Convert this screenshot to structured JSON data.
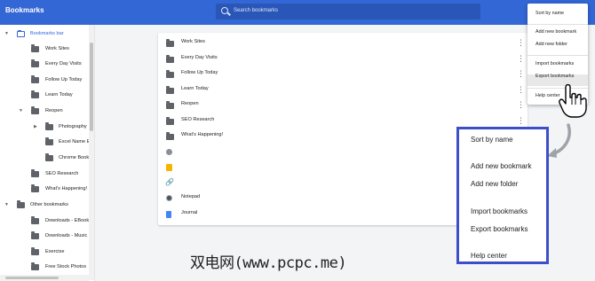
{
  "header": {
    "title": "Bookmarks",
    "search_placeholder": "Search bookmarks"
  },
  "sidebar": {
    "items": [
      {
        "label": "Bookmarks bar",
        "level": 0,
        "expanded": true,
        "selected": true
      },
      {
        "label": "Work Sites",
        "level": 1
      },
      {
        "label": "Every Day Visits",
        "level": 1
      },
      {
        "label": "Follow Up Today",
        "level": 1
      },
      {
        "label": "Learn Today",
        "level": 1
      },
      {
        "label": "Reopen",
        "level": 1,
        "expanded": true
      },
      {
        "label": "Photography",
        "level": 2,
        "collapsed": true
      },
      {
        "label": "Excel Name E",
        "level": 2
      },
      {
        "label": "Chrome Book",
        "level": 2
      },
      {
        "label": "SEO Research",
        "level": 1
      },
      {
        "label": "What's Happening!",
        "level": 1
      },
      {
        "label": "Other bookmarks",
        "level": 0,
        "expanded": true
      },
      {
        "label": "Downloads - EBook",
        "level": 1
      },
      {
        "label": "Downloads - Music",
        "level": 1
      },
      {
        "label": "Exercise",
        "level": 1
      },
      {
        "label": "Free Stock Photos",
        "level": 1
      }
    ]
  },
  "list": {
    "rows": [
      {
        "label": "Work Sites",
        "icon": "folder-icon"
      },
      {
        "label": "Every Day Visits",
        "icon": "folder-icon"
      },
      {
        "label": "Follow Up Today",
        "icon": "folder-icon"
      },
      {
        "label": "Learn Today",
        "icon": "folder-icon"
      },
      {
        "label": "Reopen",
        "icon": "folder-icon"
      },
      {
        "label": "SEO Research",
        "icon": "folder-icon"
      },
      {
        "label": "What's Happening!",
        "icon": "folder-icon"
      },
      {
        "label": "",
        "icon": "globe-icon"
      },
      {
        "label": "",
        "icon": "yellow-site-icon"
      },
      {
        "label": "",
        "icon": "link-icon"
      },
      {
        "label": "Notepad",
        "icon": "notepad-icon"
      },
      {
        "label": "Journal",
        "icon": "document-icon"
      }
    ]
  },
  "menu": {
    "items": [
      "Sort by name",
      "Add new bookmark",
      "Add new folder",
      "Import bookmarks",
      "Export bookmarks",
      "Help center"
    ],
    "highlighted": "Export bookmarks"
  },
  "zoom_menu": {
    "items": [
      "Sort by name",
      "Add new bookmark",
      "Add new folder",
      "Import bookmarks",
      "Export bookmarks",
      "Help center"
    ]
  },
  "watermark": "双电网(www.pcpc.me)",
  "colors": {
    "header": "#3367d6",
    "accent": "#3367d6",
    "zoom_border": "#3d4fc8"
  }
}
